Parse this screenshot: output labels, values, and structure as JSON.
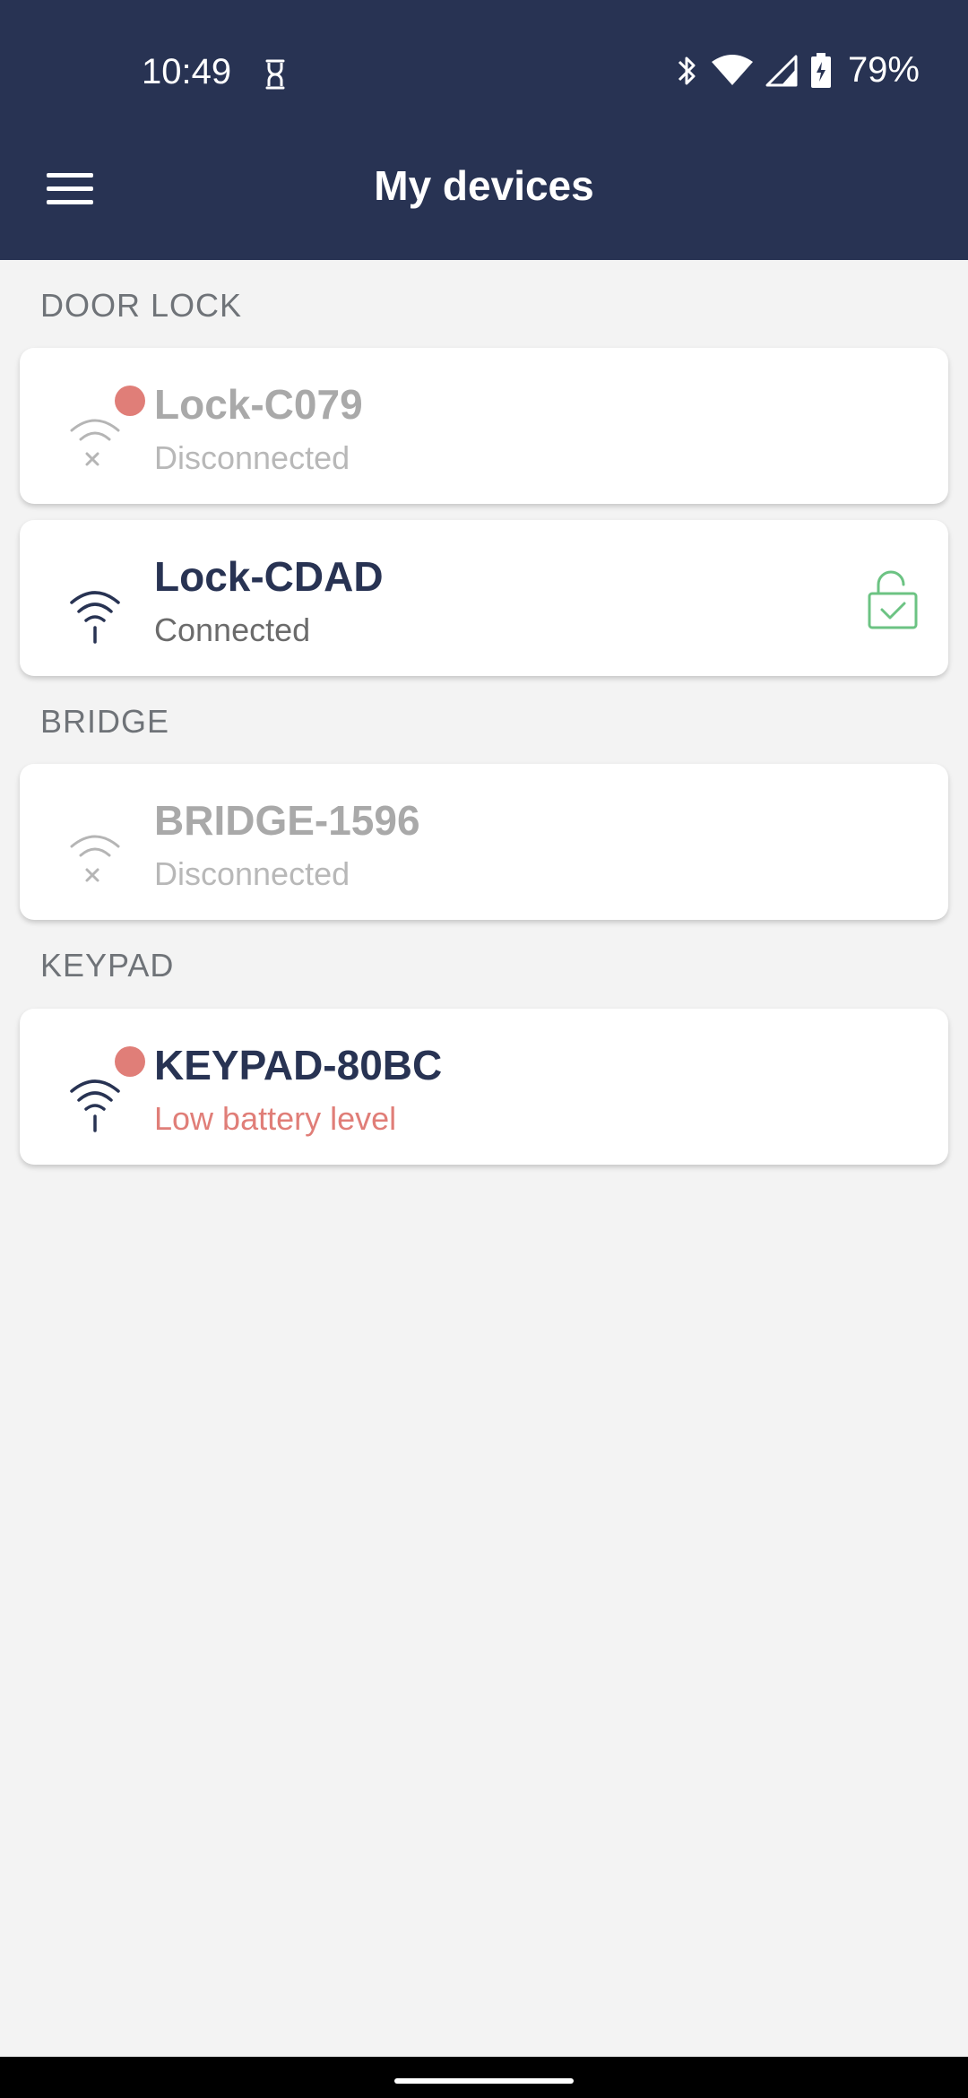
{
  "status_bar": {
    "time": "10:49",
    "battery": "79%"
  },
  "header": {
    "title": "My devices"
  },
  "sections": [
    {
      "title": "DOOR LOCK"
    },
    {
      "title": "BRIDGE"
    },
    {
      "title": "KEYPAD"
    }
  ],
  "devices": [
    {
      "name": "Lock-C079",
      "status": "Disconnected",
      "state": "disconnected",
      "alert": true
    },
    {
      "name": "Lock-CDAD",
      "status": "Connected",
      "state": "connected",
      "alert": false,
      "lock": "unlocked"
    },
    {
      "name": "BRIDGE-1596",
      "status": "Disconnected",
      "state": "disconnected",
      "alert": false
    },
    {
      "name": "KEYPAD-80BC",
      "status": "Low battery level",
      "state": "warning",
      "alert": true
    }
  ],
  "colors": {
    "header_bg": "#283353",
    "alert": "#e07e78",
    "unlocked": "#6cc383",
    "disconnected": "#a9a9a9"
  }
}
